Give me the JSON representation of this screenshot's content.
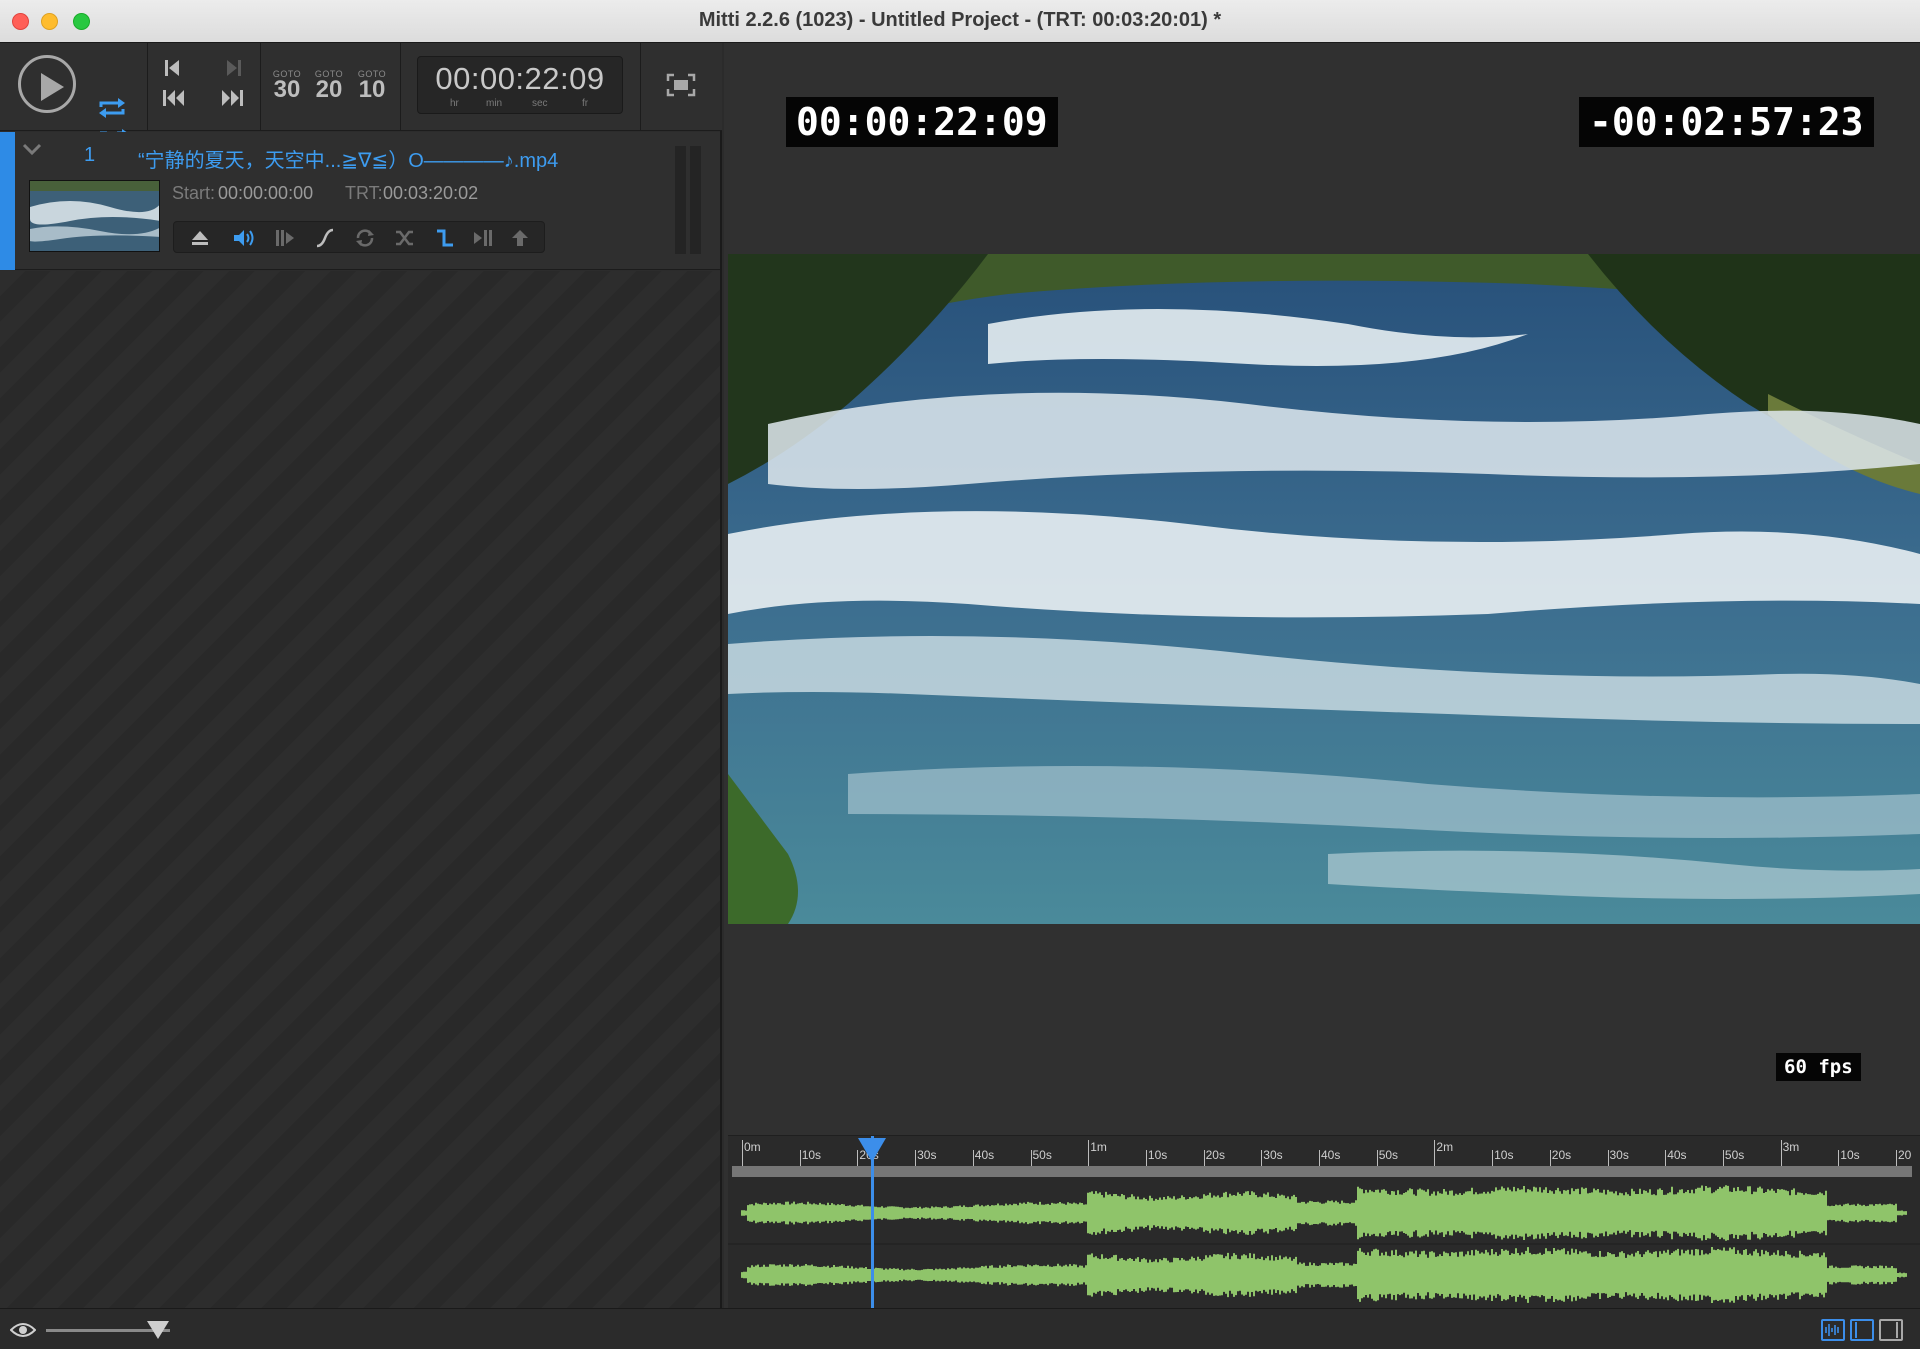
{
  "window": {
    "title": "Mitti 2.2.6 (1023) - Untitled Project - (TRT: 00:03:20:01) *"
  },
  "toolbar": {
    "goto_label": "GOTO",
    "goto_30": "30",
    "goto_20": "20",
    "goto_10": "10",
    "timecode": "00:00:22:09",
    "tc_units": {
      "hr": "hr",
      "min": "min",
      "sec": "sec",
      "fr": "fr"
    },
    "icons": [
      "play-icon",
      "loop-icon",
      "shuffle-icon",
      "previous-icon",
      "next-icon",
      "rewind-icon",
      "fast-forward-icon",
      "fullscreen-icon"
    ]
  },
  "cue": {
    "number": "1",
    "name": "“宁静的夏天，天空中...≧∇≦）O————♪.mp4",
    "start_label": "Start:",
    "start_value": "00:00:00:00",
    "trt_label": "TRT:",
    "trt_value": "00:03:20:02",
    "accent_color": "#2e8be6",
    "control_icons": [
      "eject-icon",
      "volume-icon",
      "in-point-icon",
      "fade-curve-icon",
      "loop-icon",
      "shuffle-icon",
      "follow-action-icon",
      "out-point-icon",
      "pin-icon"
    ]
  },
  "viewer": {
    "elapsed": "00:00:22:09",
    "remaining": "-00:02:57:23",
    "fps": "60 fps"
  },
  "timeline": {
    "ticks": [
      "0m",
      "10s",
      "20s",
      "30s",
      "40s",
      "50s",
      "1m",
      "10s",
      "20s",
      "30s",
      "40s",
      "50s",
      "2m",
      "10s",
      "20s",
      "30s",
      "40s",
      "50s",
      "3m",
      "10s",
      "20"
    ],
    "playhead_position_fraction": 0.111,
    "waveform_color": "#8fc46a",
    "playhead_color": "#3c8eea"
  },
  "statusbar": {
    "zoom_fraction": 0.9,
    "icons": [
      "eye-icon",
      "waveform-view-icon",
      "left-panel-view-icon",
      "right-panel-view-icon"
    ]
  }
}
